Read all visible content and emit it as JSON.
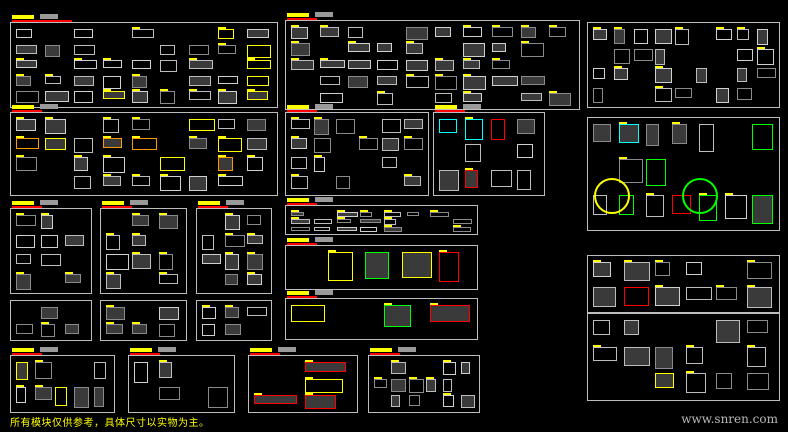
{
  "drawing": {
    "note": "所有模块仅供参考，具体尺寸以实物为主。",
    "watermark": "www.snren.com",
    "colors": {
      "background": "#000000",
      "frame": "#bdbdbd",
      "label": "#ffff00",
      "accent": "#ff0000",
      "highlight": "#00ffff",
      "green": "#00ff00",
      "orange": "#ff9900"
    }
  }
}
